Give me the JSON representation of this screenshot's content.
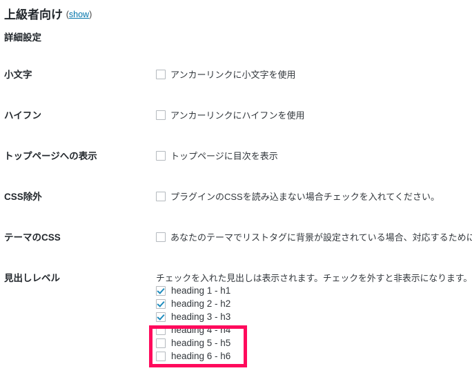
{
  "section": {
    "title": "上級者向け",
    "toggle_open_paren": "(",
    "toggle_label": "show",
    "toggle_close_paren": ")",
    "subtitle": "詳細設定"
  },
  "rows": [
    {
      "label": "小文字",
      "checkbox_label": "アンカーリンクに小文字を使用",
      "checked": false
    },
    {
      "label": "ハイフン",
      "checkbox_label": "アンカーリンクにハイフンを使用",
      "checked": false
    },
    {
      "label": "トップページへの表示",
      "checkbox_label": "トップページに目次を表示",
      "checked": false
    },
    {
      "label": "CSS除外",
      "checkbox_label": "プラグインのCSSを読み込まない場合チェックを入れてください。",
      "checked": false
    },
    {
      "label": "テーマのCSS",
      "checkbox_label": "あなたのテーマでリストタグに背景が設定されている場合、対応するために",
      "checked": false
    }
  ],
  "heading_level": {
    "label": "見出しレベル",
    "hint": "チェックを入れた見出しは表示されます。チェックを外すと非表示になります。",
    "items": [
      {
        "label": "heading 1 - h1",
        "checked": true
      },
      {
        "label": "heading 2 - h2",
        "checked": true
      },
      {
        "label": "heading 3 - h3",
        "checked": true
      },
      {
        "label": "heading 4 - h4",
        "checked": false
      },
      {
        "label": "heading 5 - h5",
        "checked": false
      },
      {
        "label": "heading 6 - h6",
        "checked": false
      }
    ]
  },
  "annotation": {
    "color": "#ff0a5c",
    "highlights": [
      "heading 4 - h4",
      "heading 5 - h5",
      "heading 6 - h6"
    ]
  },
  "colors": {
    "link": "#0073aa",
    "text": "#32373c",
    "label": "#23282d",
    "checkbox_border": "#b4b9be",
    "check_mark": "#1e8cbe",
    "annotation": "#ff0a5c",
    "background": "#ffffff"
  }
}
